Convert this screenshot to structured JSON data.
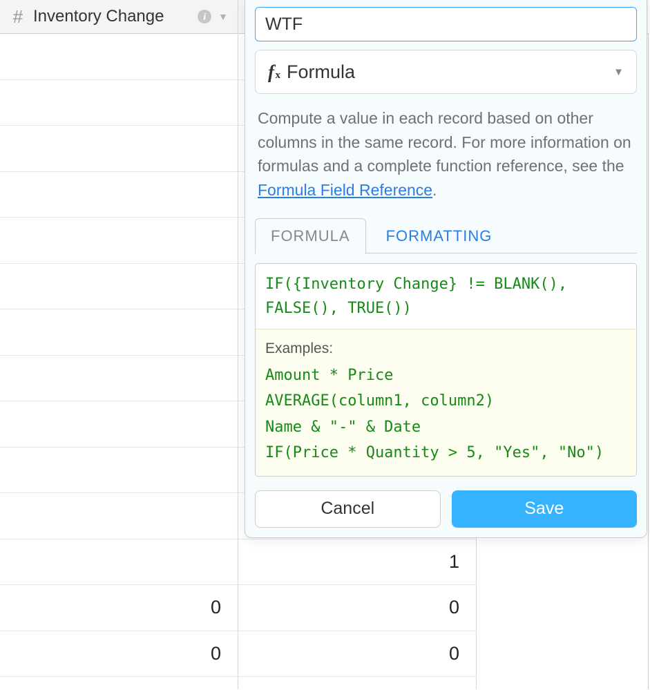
{
  "column_header": {
    "name": "Inventory Change"
  },
  "rows_left": [
    "",
    "",
    "",
    "",
    "",
    "",
    "",
    "",
    "",
    "",
    "",
    "",
    "0",
    "0"
  ],
  "rows_right": [
    "",
    "",
    "",
    "",
    "",
    "",
    "",
    "",
    "",
    "",
    "",
    "1",
    "0",
    "0"
  ],
  "panel": {
    "field_name": "WTF",
    "type_label": "Formula",
    "description_pre": "Compute a value in each record based on other columns in the same record. For more information on formulas and a complete function reference, see the ",
    "description_link": "Formula Field Reference",
    "description_post": ".",
    "tabs": {
      "formula": "FORMULA",
      "formatting": "FORMATTING"
    },
    "formula": "IF({Inventory Change} != BLANK(), FALSE(), TRUE())",
    "examples_title": "Examples:",
    "examples": [
      "Amount * Price",
      "AVERAGE(column1, column2)",
      "Name & \"-\" & Date",
      "IF(Price * Quantity > 5, \"Yes\", \"No\")"
    ],
    "cancel": "Cancel",
    "save": "Save"
  }
}
